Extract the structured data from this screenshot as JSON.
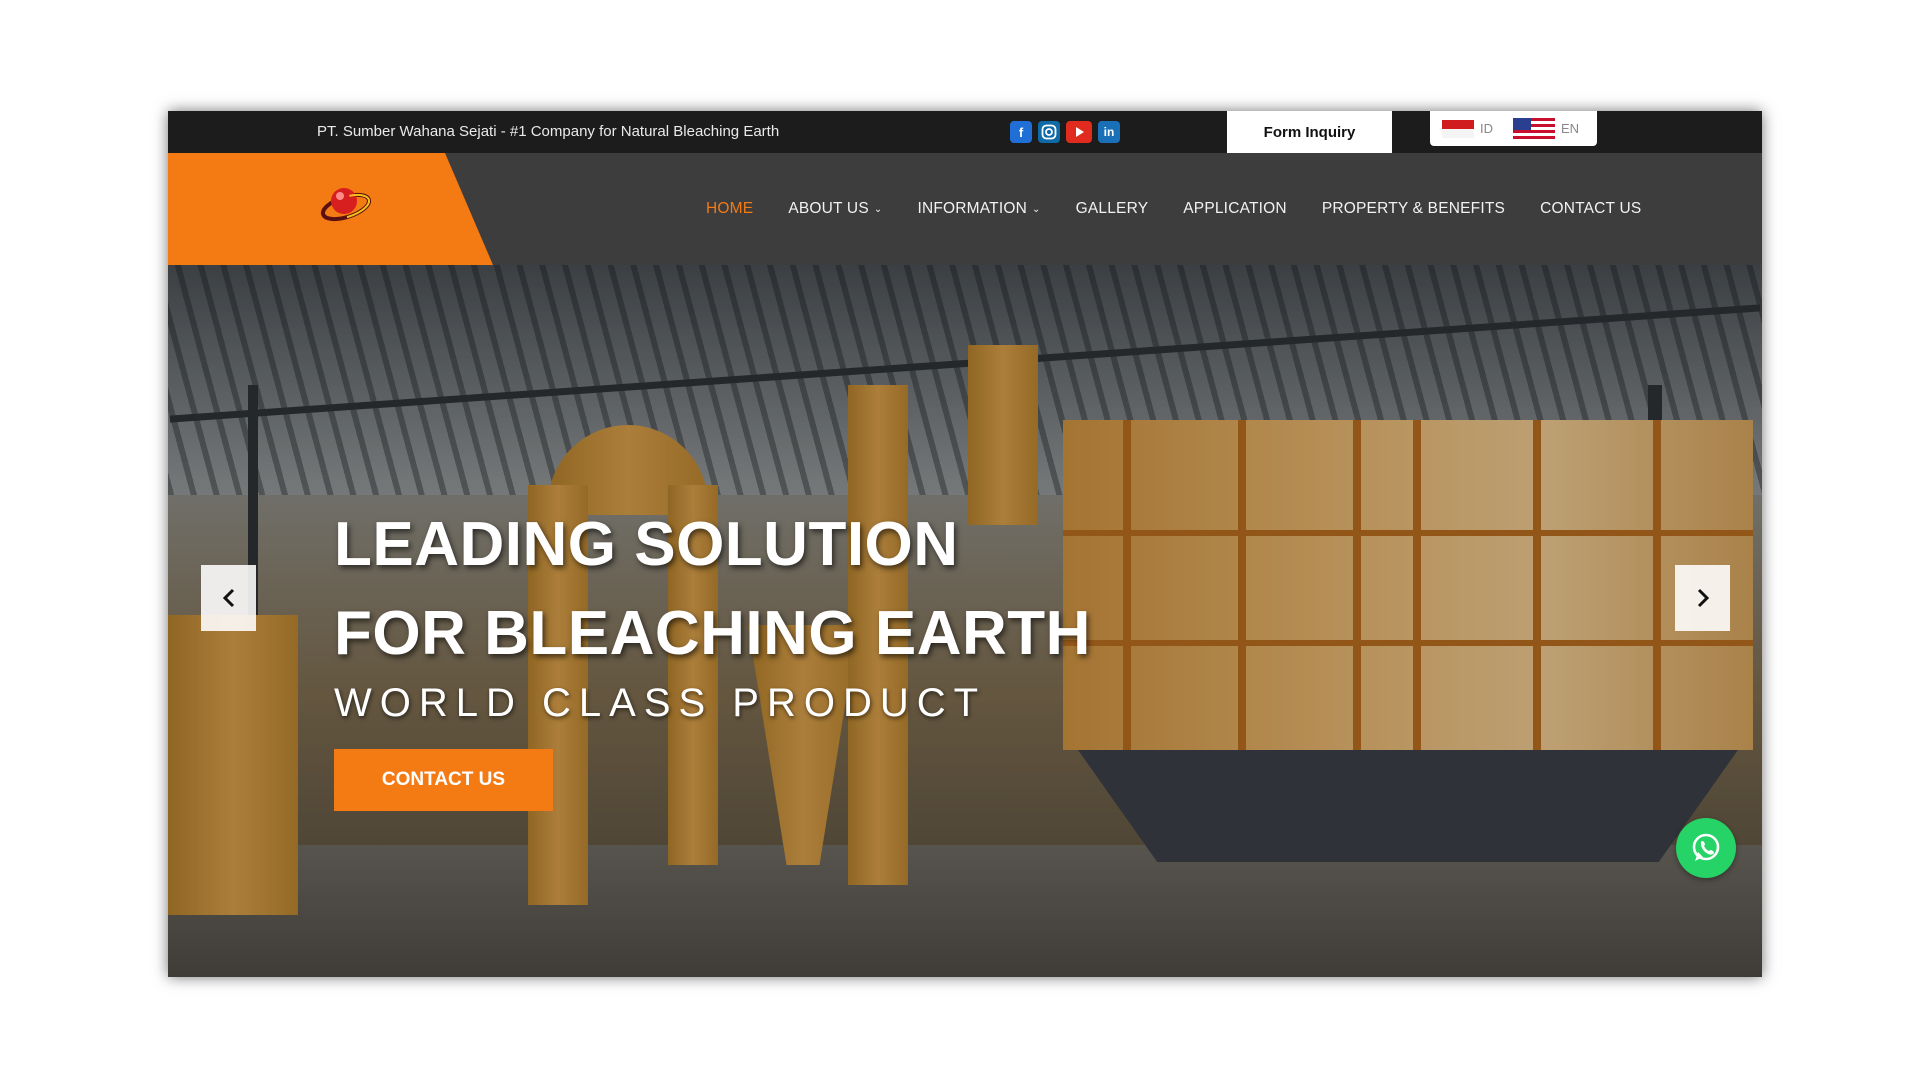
{
  "topbar": {
    "tagline": "PT. Sumber Wahana Sejati - #1 Company for Natural Bleaching Earth",
    "socials": [
      "facebook-icon",
      "instagram-icon",
      "youtube-icon",
      "linkedin-icon"
    ],
    "inquiry_label": "Form Inquiry",
    "languages": [
      {
        "code": "ID",
        "flag": "indonesia-flag-icon"
      },
      {
        "code": "EN",
        "flag": "us-flag-icon"
      }
    ]
  },
  "nav": {
    "items": [
      {
        "label": "HOME",
        "active": true
      },
      {
        "label": "ABOUT US",
        "dropdown": true
      },
      {
        "label": "INFORMATION",
        "dropdown": true
      },
      {
        "label": "GALLERY"
      },
      {
        "label": "APPLICATION"
      },
      {
        "label": "PROPERTY & BENEFITS"
      },
      {
        "label": "CONTACT US"
      }
    ]
  },
  "hero": {
    "title_line1": "LEADING SOLUTION",
    "title_line2": "FOR BLEACHING EARTH",
    "subtitle": "WORLD CLASS PRODUCT",
    "cta_label": "CONTACT US"
  },
  "colors": {
    "accent": "#f47a14",
    "nav_bg": "#3d3d3d",
    "topbar_bg": "#1c1c1c",
    "whatsapp": "#25d366"
  }
}
